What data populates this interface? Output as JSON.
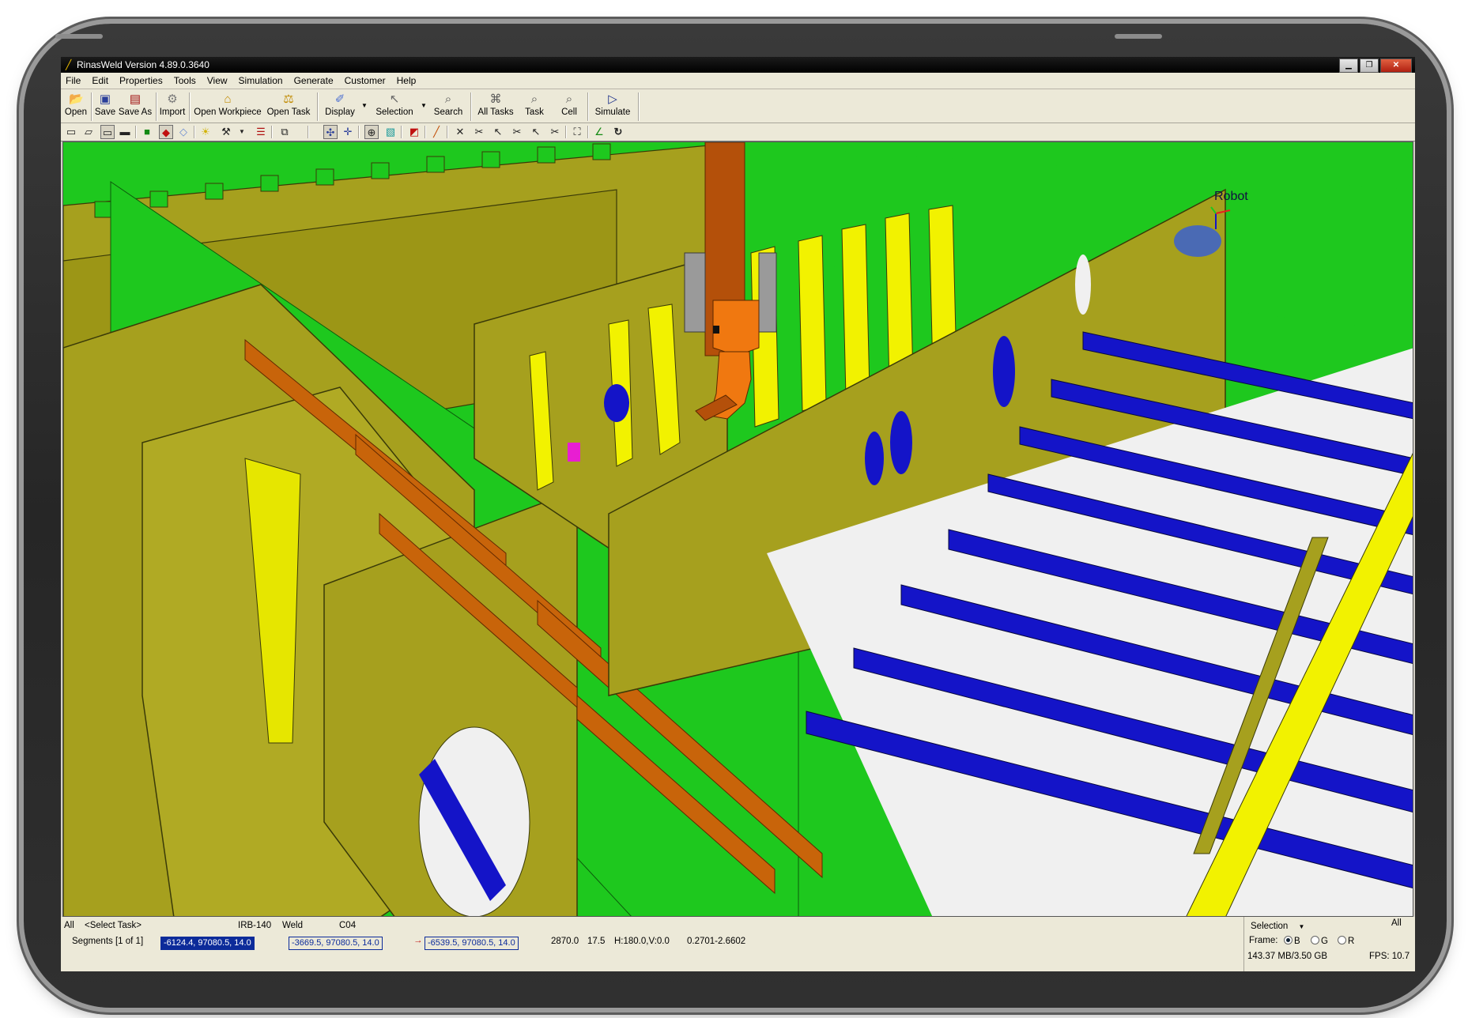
{
  "window": {
    "title": "RinasWeld Version 4.89.0.3640"
  },
  "menu": [
    "File",
    "Edit",
    "Properties",
    "Tools",
    "View",
    "Simulation",
    "Generate",
    "Customer",
    "Help"
  ],
  "toolbar": {
    "open": "Open",
    "save": "Save",
    "save_as": "Save As",
    "import": "Import",
    "open_workpiece": "Open Workpiece",
    "open_task": "Open Task",
    "display": "Display",
    "selection": "Selection",
    "search": "Search",
    "all_tasks": "All Tasks",
    "task": "Task",
    "cell": "Cell",
    "simulate": "Simulate"
  },
  "viewport": {
    "robot_label": "Robot"
  },
  "status": {
    "all": "All",
    "select_task": "<Select Task>",
    "robot_model": "IRB-140",
    "mode": "Weld",
    "code": "C04",
    "segments": "Segments [1 of 1]",
    "coord1": "-6124.4, 97080.5, 14.0",
    "coord2": "-3669.5, 97080.5, 14.0",
    "coord3": "-6539.5, 97080.5, 14.0",
    "length": "2870.0",
    "value2": "17.5",
    "angles": "H:180.0,V:0.0",
    "range": "0.2701-2.6602"
  },
  "selection_panel": {
    "label": "Selection",
    "all": "All",
    "frame_label": "Frame:",
    "frame_options": [
      "B",
      "G",
      "R"
    ],
    "frame_selected": "B",
    "memory": "143.37 MB/3.50 GB",
    "fps": "FPS: 10.7"
  },
  "colors": {
    "plate_olive": "#a6a01e",
    "frame_green": "#1ec81e",
    "stiffener_blue": "#1414c8",
    "highlight_yellow": "#f2f200",
    "girder_orange": "#c8640a",
    "robot_arm": "#b4500a"
  }
}
